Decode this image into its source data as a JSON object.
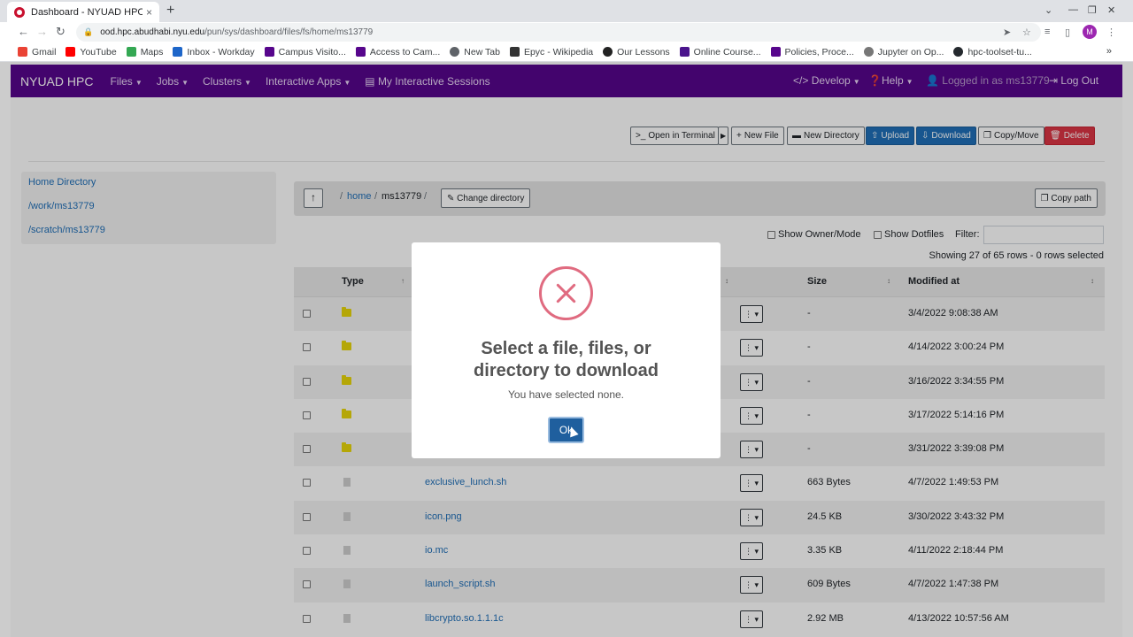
{
  "browser": {
    "tab_title": "Dashboard - NYUAD HPC",
    "tab_close": "×",
    "new_tab": "+",
    "url_host": "ood.hpc.abudhabi.nyu.edu",
    "url_path": "/pun/sys/dashboard/files/fs/home/ms13779",
    "avatar_letter": "M",
    "bookmarks": [
      {
        "label": "Gmail",
        "color": "#ea4335"
      },
      {
        "label": "YouTube",
        "color": "#ff0000"
      },
      {
        "label": "Maps",
        "color": "#34a853"
      },
      {
        "label": "Inbox - Workday",
        "color": "#1e66c9"
      },
      {
        "label": "Campus Visito...",
        "color": "#57068c"
      },
      {
        "label": "Access to Cam...",
        "color": "#57068c"
      },
      {
        "label": "New Tab",
        "color": "#5f6368"
      },
      {
        "label": "Epyc - Wikipedia",
        "color": "#333333"
      },
      {
        "label": "Our Lessons",
        "color": "#222222"
      },
      {
        "label": "Online Course...",
        "color": "#4a148c"
      },
      {
        "label": "Policies, Proce...",
        "color": "#57068c"
      },
      {
        "label": "Jupyter on Op...",
        "color": "#777777"
      },
      {
        "label": "hpc-toolset-tu...",
        "color": "#24292e"
      }
    ],
    "bookmarks_more": "»"
  },
  "nav": {
    "brand": "NYUAD HPC",
    "items": [
      "Files",
      "Jobs",
      "Clusters",
      "Interactive Apps"
    ],
    "sessions": "My Interactive Sessions",
    "develop": "Develop",
    "help": "Help",
    "logged_in": "Logged in as ms13779",
    "logout": "Log Out"
  },
  "toolbar": {
    "open_terminal": "Open in Terminal",
    "new_file": "New File",
    "new_directory": "New Directory",
    "upload": "Upload",
    "download": "Download",
    "copy_move": "Copy/Move",
    "delete": "Delete"
  },
  "sidebar": {
    "items": [
      "Home Directory",
      "/work/ms13779",
      "/scratch/ms13779"
    ]
  },
  "path": {
    "home": "home",
    "user": "ms13779",
    "change_directory": "Change directory",
    "copy_path": "Copy path"
  },
  "options": {
    "show_owner": "Show Owner/Mode",
    "show_dotfiles": "Show Dotfiles",
    "filter_label": "Filter:",
    "showing": "Showing 27 of 65 rows - 0 rows selected"
  },
  "table": {
    "headers": {
      "type": "Type",
      "size": "Size",
      "modified": "Modified at"
    },
    "rows": [
      {
        "type": "folder",
        "name": "",
        "size": "-",
        "modified": "3/4/2022 9:08:38 AM"
      },
      {
        "type": "folder",
        "name": "",
        "size": "-",
        "modified": "4/14/2022 3:00:24 PM"
      },
      {
        "type": "folder",
        "name": "",
        "size": "-",
        "modified": "3/16/2022 3:34:55 PM"
      },
      {
        "type": "folder",
        "name": "",
        "size": "-",
        "modified": "3/17/2022 5:14:16 PM"
      },
      {
        "type": "folder",
        "name": "",
        "size": "-",
        "modified": "3/31/2022 3:39:08 PM"
      },
      {
        "type": "file",
        "name": "exclusive_lunch.sh",
        "size": "663 Bytes",
        "modified": "4/7/2022 1:49:53 PM"
      },
      {
        "type": "file",
        "name": "icon.png",
        "size": "24.5 KB",
        "modified": "3/30/2022 3:43:32 PM"
      },
      {
        "type": "file",
        "name": "io.mc",
        "size": "3.35 KB",
        "modified": "4/11/2022 2:18:44 PM"
      },
      {
        "type": "file",
        "name": "launch_script.sh",
        "size": "609 Bytes",
        "modified": "4/7/2022 1:47:38 PM"
      },
      {
        "type": "file",
        "name": "libcrypto.so.1.1.1c",
        "size": "2.92 MB",
        "modified": "4/13/2022 10:57:56 AM"
      }
    ]
  },
  "modal": {
    "title": "Select a file, files, or directory to download",
    "text": "You have selected none.",
    "ok": "Ok"
  }
}
